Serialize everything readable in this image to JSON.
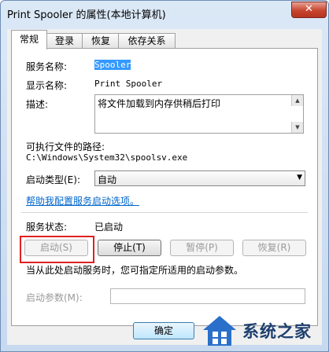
{
  "window": {
    "title": "Print Spooler 的属性(本地计算机)",
    "close_glyph": "✕"
  },
  "tabs": [
    {
      "label": "常规",
      "active": true
    },
    {
      "label": "登录",
      "active": false
    },
    {
      "label": "恢复",
      "active": false
    },
    {
      "label": "依存关系",
      "active": false
    }
  ],
  "general": {
    "service_name_label": "服务名称:",
    "service_name_value": "Spooler",
    "display_name_label": "显示名称:",
    "display_name_value": "Print Spooler",
    "description_label": "描述:",
    "description_value": "将文件加载到内存供稍后打印",
    "path_label": "可执行文件的路径:",
    "path_value": "C:\\Windows\\System32\\spoolsv.exe",
    "startup_type_label": "启动类型(E):",
    "startup_type_value": "自动",
    "help_link": "帮助我配置服务启动选项。",
    "status_label": "服务状态:",
    "status_value": "已启动",
    "start_button": "启动(S)",
    "stop_button": "停止(T)",
    "pause_button": "暂停(P)",
    "resume_button": "恢复(R)",
    "hint_text": "当从此处启动服务时，您可指定所适用的启动参数。",
    "start_params_label": "启动参数(M):",
    "start_params_value": ""
  },
  "footer": {
    "ok_button": "确定"
  },
  "watermark": {
    "text": "系统之家",
    "logo": "house-logo-icon"
  },
  "colors": {
    "highlight": "#e02020",
    "link": "#0066cc",
    "selection": "#3399ff"
  }
}
